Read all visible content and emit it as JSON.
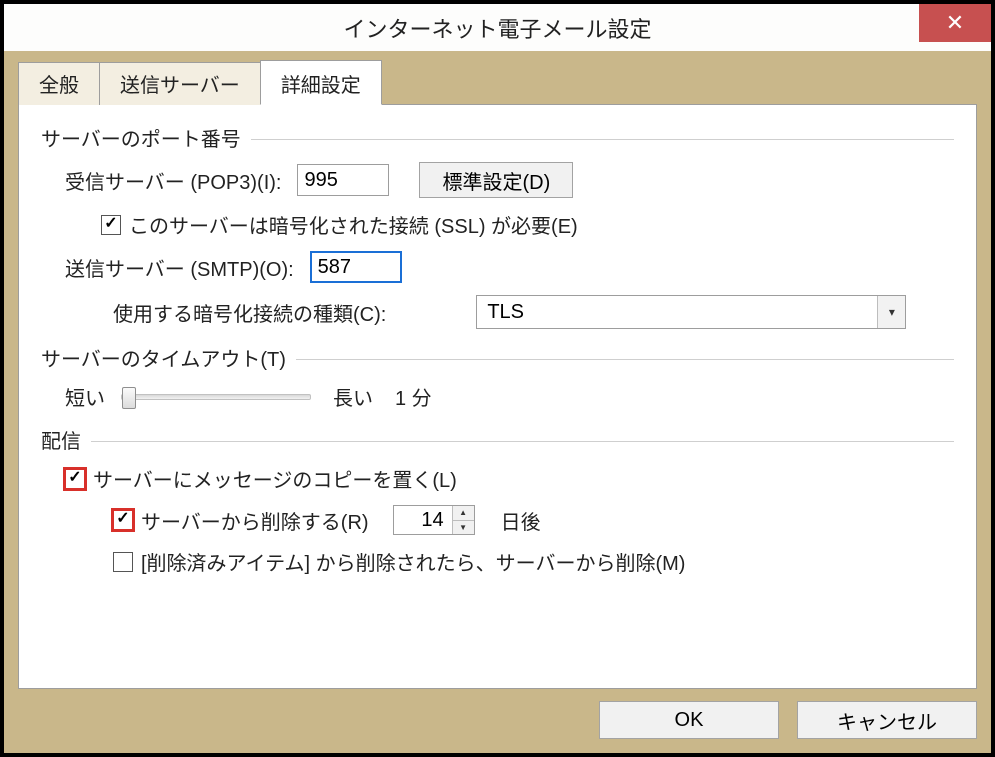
{
  "window": {
    "title": "インターネット電子メール設定",
    "close_label": "✕"
  },
  "tabs": {
    "general": "全般",
    "outgoing": "送信サーバー",
    "advanced": "詳細設定"
  },
  "groups": {
    "ports_title": "サーバーのポート番号",
    "timeout_title": "サーバーのタイムアウト(T)",
    "delivery_title": "配信"
  },
  "ports": {
    "incoming_label": "受信サーバー (POP3)(I):",
    "incoming_value": "995",
    "defaults_button": "標準設定(D)",
    "ssl_checkbox_label": "このサーバーは暗号化された接続 (SSL) が必要(E)",
    "outgoing_label": "送信サーバー (SMTP)(O):",
    "outgoing_value": "587",
    "encryption_label": "使用する暗号化接続の種類(C):",
    "encryption_selected": "TLS"
  },
  "timeout": {
    "short_label": "短い",
    "long_label": "長い",
    "value_label": "1 分"
  },
  "delivery": {
    "leave_copy_label": "サーバーにメッセージのコピーを置く(L)",
    "remove_after_label": "サーバーから削除する(R)",
    "remove_after_days": "14",
    "days_suffix": "日後",
    "remove_when_deleted_label": "[削除済みアイテム] から削除されたら、サーバーから削除(M)"
  },
  "buttons": {
    "ok": "OK",
    "cancel": "キャンセル"
  }
}
